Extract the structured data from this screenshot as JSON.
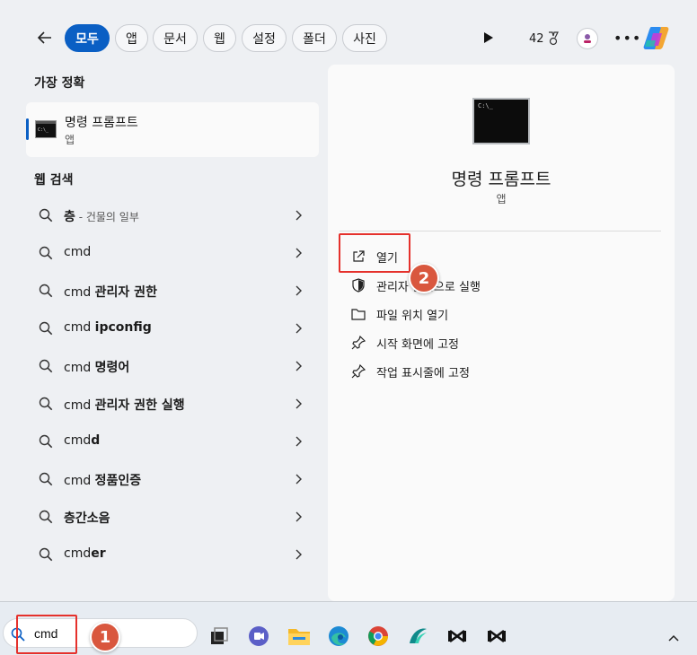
{
  "filter_bar": {
    "chips": [
      "모두",
      "앱",
      "문서",
      "웹",
      "설정",
      "폴더",
      "사진"
    ],
    "points": "42"
  },
  "left": {
    "best_match_title": "가장 정확",
    "best_match": {
      "name": "명령 프롬프트",
      "type": "앱"
    },
    "web_search_title": "웹 검색",
    "results": [
      {
        "prefix": "",
        "bold": "층",
        "hint": " - 건물의 일부"
      },
      {
        "prefix": "cmd",
        "bold": "",
        "hint": ""
      },
      {
        "prefix": "cmd ",
        "bold": "관리자 권한",
        "hint": ""
      },
      {
        "prefix": "cmd ",
        "bold": "ipconfig",
        "hint": ""
      },
      {
        "prefix": "cmd ",
        "bold": "명령어",
        "hint": ""
      },
      {
        "prefix": "cmd ",
        "bold": "관리자 권한 실행",
        "hint": ""
      },
      {
        "prefix": "cmd",
        "bold": "d",
        "hint": ""
      },
      {
        "prefix": "cmd ",
        "bold": "정품인증",
        "hint": ""
      },
      {
        "prefix": "",
        "bold": "층간소음",
        "hint": ""
      },
      {
        "prefix": "cmd",
        "bold": "er",
        "hint": ""
      }
    ]
  },
  "preview": {
    "title": "명령 프롬프트",
    "type": "앱",
    "actions": [
      "열기",
      "관리자 권한으로 실행",
      "파일 위치 열기",
      "시작 화면에 고정",
      "작업 표시줄에 고정"
    ]
  },
  "annotations": {
    "badge1": "1",
    "badge2": "2"
  },
  "taskbar": {
    "search_value": "cmd"
  },
  "colors": {
    "accent": "#0a5fc4",
    "highlight_box": "#e5312c",
    "badge": "#d9573e"
  }
}
